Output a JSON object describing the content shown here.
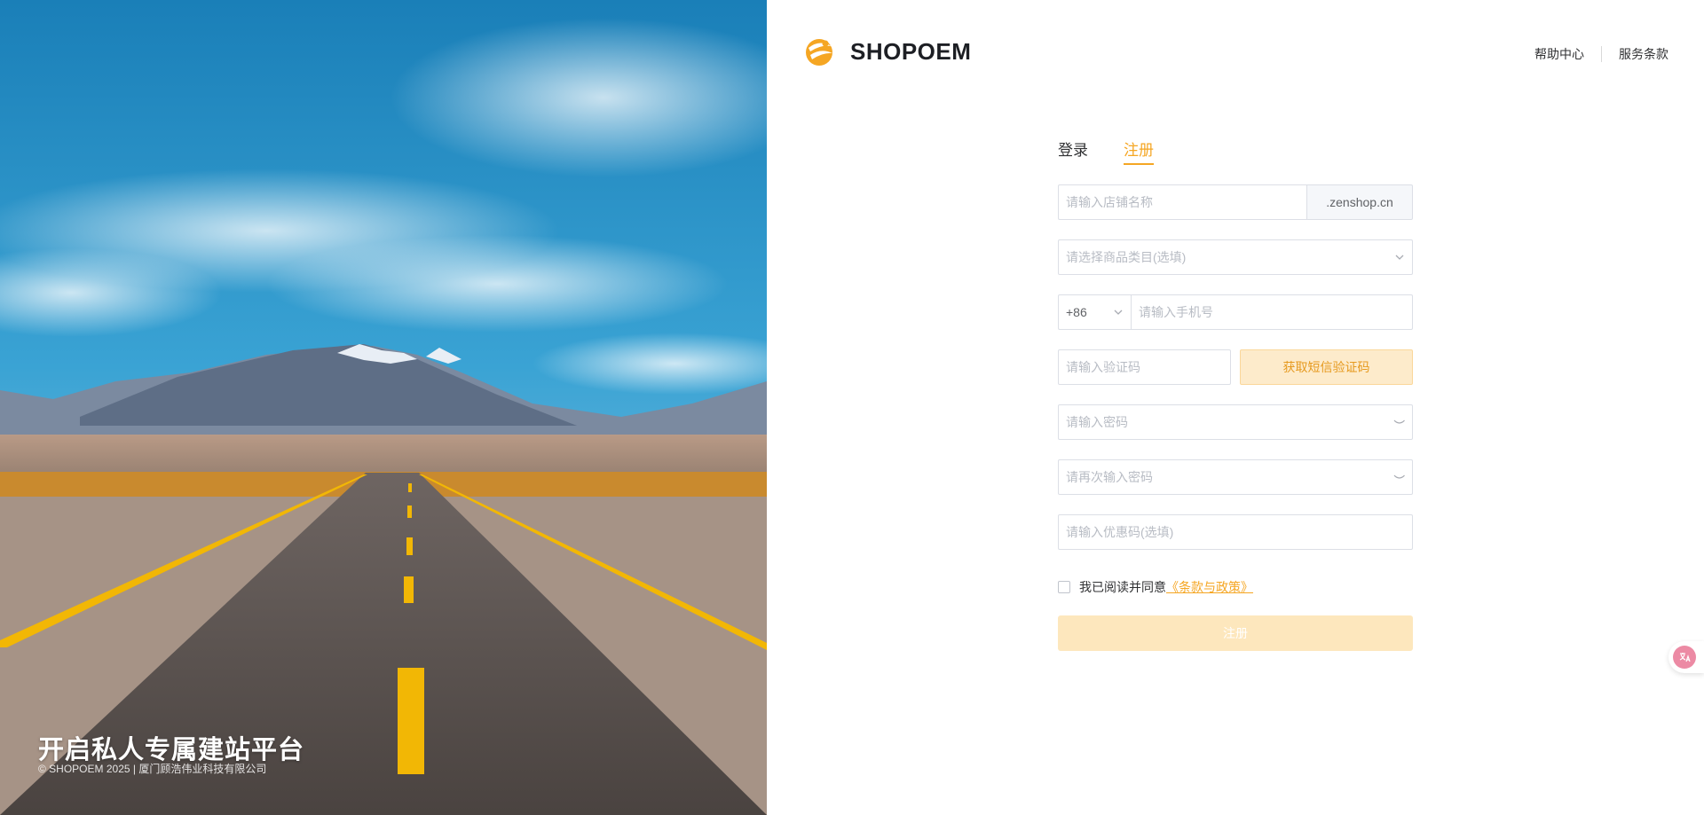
{
  "hero": {
    "slogan": "开启私人专属建站平台",
    "copyright": "© SHOPOEM 2025 | 厦门顾浩伟业科技有限公司"
  },
  "header": {
    "brand": "SHOPOEM",
    "links": [
      "帮助中心",
      "服务条款"
    ]
  },
  "tabs": {
    "login": "登录",
    "register": "注册",
    "active": "注册"
  },
  "form": {
    "store_name_placeholder": "请输入店铺名称",
    "store_suffix": ".zenshop.cn",
    "category_placeholder": "请选择商品类目(选填)",
    "country_code": "+86",
    "phone_placeholder": "请输入手机号",
    "sms_code_placeholder": "请输入验证码",
    "sms_button": "获取短信验证码",
    "password_placeholder": "请输入密码",
    "confirm_password_placeholder": "请再次输入密码",
    "coupon_placeholder": "请输入优惠码(选填)",
    "agree_text": "我已阅读并同意",
    "agree_link": "《条款与政策》",
    "submit": "注册"
  },
  "colors": {
    "accent": "#f5a623",
    "button_disabled": "#fde7bd",
    "sms_button_bg": "#fdebcb"
  },
  "icons": [
    "brand-logo-icon",
    "chevron-down-icon",
    "eye-closed-icon",
    "translate-icon"
  ]
}
